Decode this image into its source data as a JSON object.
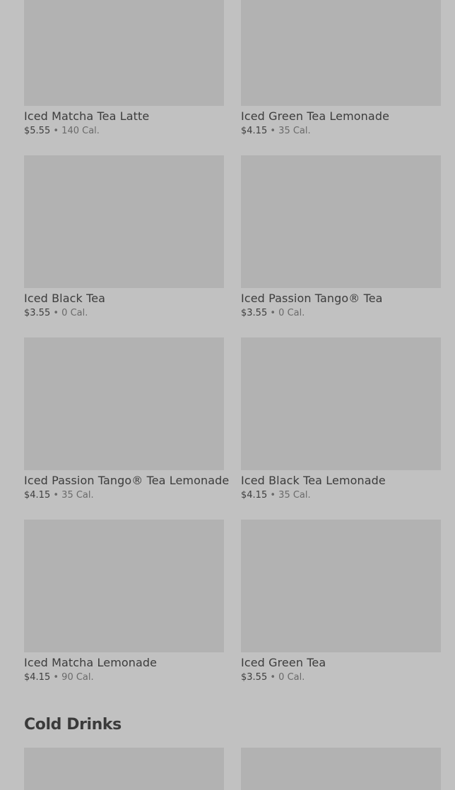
{
  "tea_items": [
    {
      "name": "Iced Matcha Tea Latte",
      "price": "$5.55",
      "separator": "•",
      "calories": "140 Cal."
    },
    {
      "name": "Iced Green Tea Lemonade",
      "price": "$4.15",
      "separator": "•",
      "calories": "35 Cal."
    },
    {
      "name": "Iced Black Tea",
      "price": "$3.55",
      "separator": "•",
      "calories": "0 Cal."
    },
    {
      "name": "Iced Passion Tango® Tea",
      "price": "$3.55",
      "separator": "•",
      "calories": "0 Cal."
    },
    {
      "name": "Iced Passion Tango® Tea Lemonade",
      "price": "$4.15",
      "separator": "•",
      "calories": "35 Cal."
    },
    {
      "name": "Iced Black Tea Lemonade",
      "price": "$4.15",
      "separator": "•",
      "calories": "35 Cal."
    },
    {
      "name": "Iced Matcha Lemonade",
      "price": "$4.15",
      "separator": "•",
      "calories": "90 Cal."
    },
    {
      "name": "Iced Green Tea",
      "price": "$3.55",
      "separator": "•",
      "calories": "0 Cal."
    }
  ],
  "next_section": {
    "title": "Cold Drinks"
  },
  "colors": {
    "background": "#c1c1c1",
    "image_placeholder": "#b2b2b2",
    "text": "#3a3a3a"
  }
}
